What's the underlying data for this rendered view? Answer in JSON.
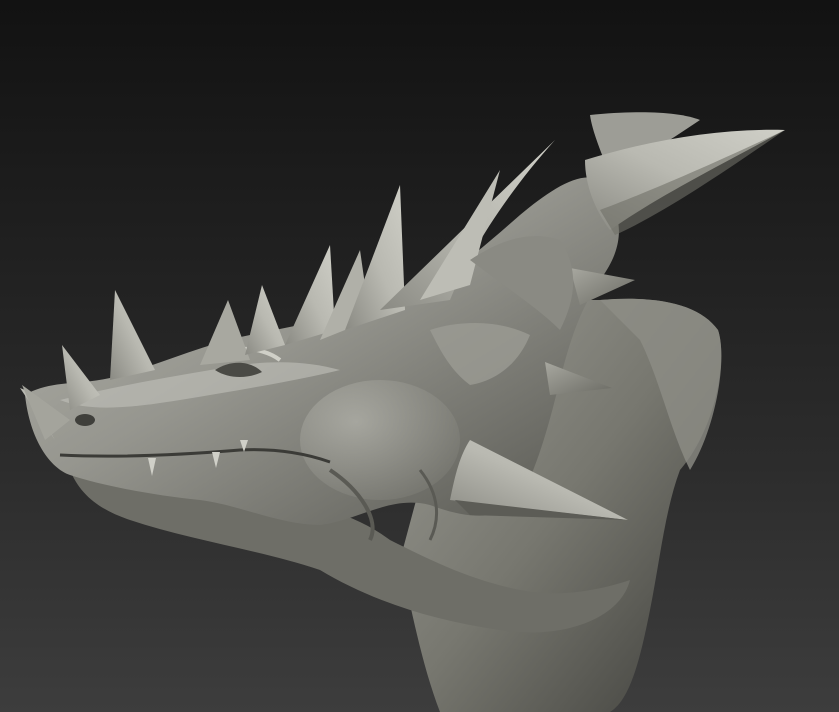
{
  "scene": {
    "subject": "dragon-head-sculpt",
    "colors": {
      "background_top": "#121212",
      "background_bottom": "#3d3d3d",
      "clay_light": "#b9b9b1",
      "clay_mid": "#8f8f88",
      "clay_dark": "#4f4f4a",
      "clay_shadow": "#2c2c29"
    }
  }
}
